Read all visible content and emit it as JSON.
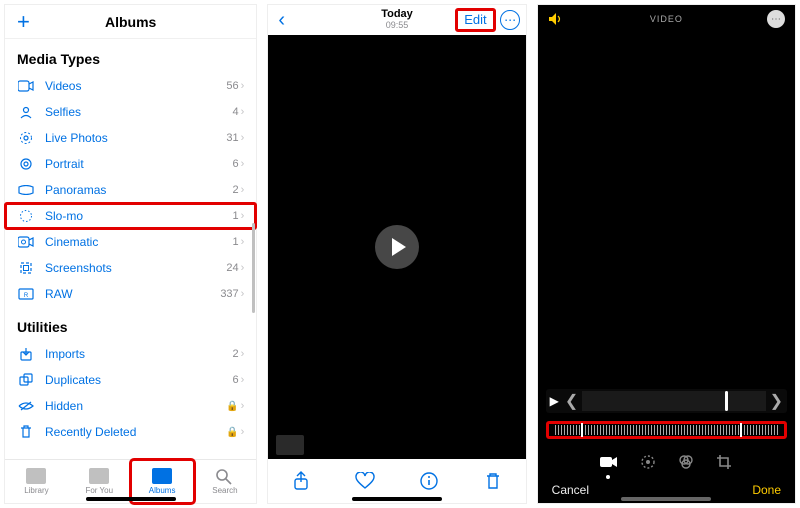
{
  "phone1": {
    "header": {
      "plus": "+",
      "title": "Albums"
    },
    "sections": {
      "media_title": "Media Types",
      "utilities_title": "Utilities"
    },
    "media": [
      {
        "icon": "videos",
        "label": "Videos",
        "count": "56"
      },
      {
        "icon": "selfies",
        "label": "Selfies",
        "count": "4"
      },
      {
        "icon": "livephotos",
        "label": "Live Photos",
        "count": "31"
      },
      {
        "icon": "portrait",
        "label": "Portrait",
        "count": "6"
      },
      {
        "icon": "panoramas",
        "label": "Panoramas",
        "count": "2"
      },
      {
        "icon": "slomo",
        "label": "Slo-mo",
        "count": "1",
        "highlight": true
      },
      {
        "icon": "cinematic",
        "label": "Cinematic",
        "count": "1"
      },
      {
        "icon": "screenshots",
        "label": "Screenshots",
        "count": "24"
      },
      {
        "icon": "raw",
        "label": "RAW",
        "count": "337"
      }
    ],
    "utilities": [
      {
        "icon": "imports",
        "label": "Imports",
        "count": "2"
      },
      {
        "icon": "duplicates",
        "label": "Duplicates",
        "count": "6"
      },
      {
        "icon": "hidden",
        "label": "Hidden",
        "locked": true
      },
      {
        "icon": "recentlydeleted",
        "label": "Recently Deleted",
        "locked": true
      }
    ],
    "tabs": {
      "library": "Library",
      "foryou": "For You",
      "albums": "Albums",
      "search": "Search"
    },
    "chevron": "›",
    "lock": "🔒"
  },
  "phone2": {
    "header": {
      "back": "‹",
      "title_day": "Today",
      "title_time": "09:55",
      "edit": "Edit",
      "more": "⋯"
    },
    "toolbar_icons": {
      "share": "share",
      "favorite": "heart",
      "info": "info",
      "trash": "trash"
    }
  },
  "phone3": {
    "header": {
      "title": "VIDEO",
      "more": "⋯"
    },
    "footer": {
      "cancel": "Cancel",
      "done": "Done"
    }
  }
}
